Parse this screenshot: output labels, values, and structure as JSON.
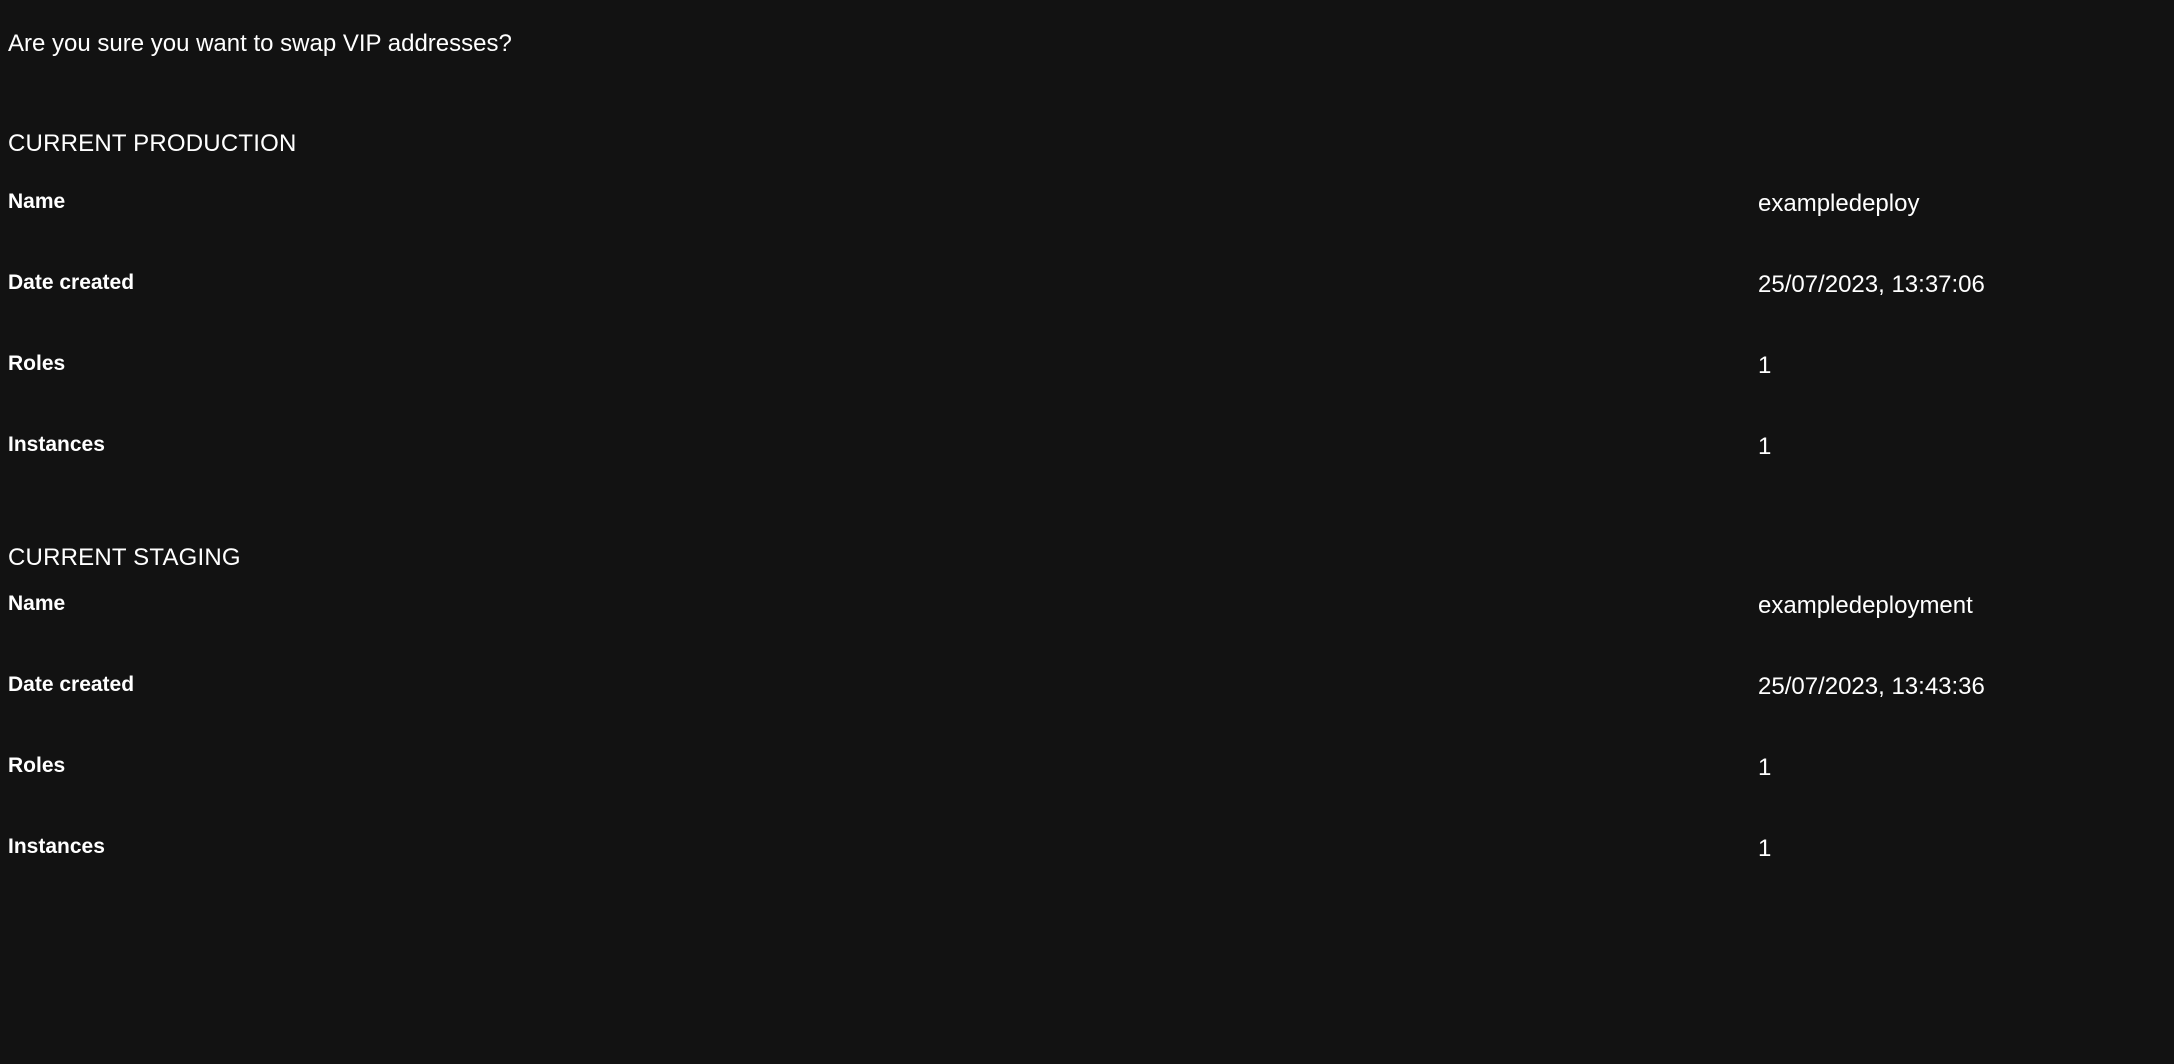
{
  "dialog": {
    "question": "Are you sure you want to swap VIP addresses?",
    "background_color": "#121212",
    "text_color": "#ffffff"
  },
  "sections": [
    {
      "header": "CURRENT PRODUCTION",
      "rows": [
        {
          "label": "Name",
          "value": "exampledeploy"
        },
        {
          "label": "Date created",
          "value": "25/07/2023, 13:37:06"
        },
        {
          "label": "Roles",
          "value": "1"
        },
        {
          "label": "Instances",
          "value": "1"
        }
      ]
    },
    {
      "header": "CURRENT STAGING",
      "rows": [
        {
          "label": "Name",
          "value": "exampledeployment"
        },
        {
          "label": "Date created",
          "value": "25/07/2023, 13:43:36"
        },
        {
          "label": "Roles",
          "value": "1"
        },
        {
          "label": "Instances",
          "value": "1"
        }
      ]
    }
  ]
}
